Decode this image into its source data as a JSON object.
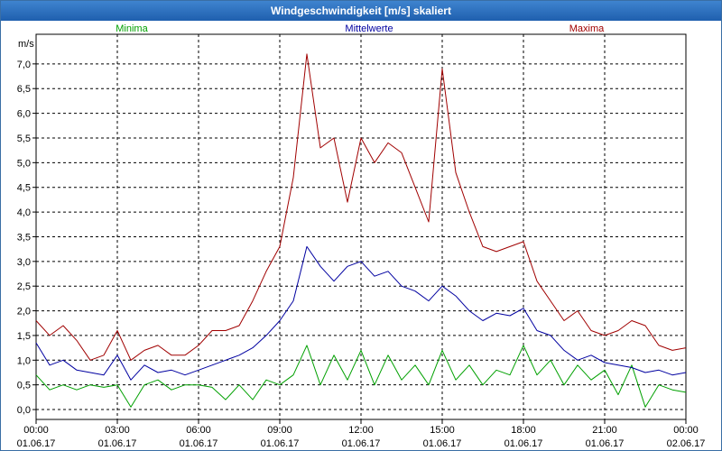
{
  "window": {
    "title": "Windgeschwindigkeit [m/s] skaliert"
  },
  "chart_data": {
    "type": "line",
    "title": "Windgeschwindigkeit [m/s] skaliert",
    "ylabel": "m/s",
    "xlabel": "",
    "ylim": [
      -0.2,
      7.6
    ],
    "xlim": [
      0,
      24
    ],
    "grid": true,
    "legend_position": "top",
    "y_ticks": [
      {
        "v": 0.0,
        "label": "0,0"
      },
      {
        "v": 0.5,
        "label": "0,5"
      },
      {
        "v": 1.0,
        "label": "1,0"
      },
      {
        "v": 1.5,
        "label": "1,5"
      },
      {
        "v": 2.0,
        "label": "2,0"
      },
      {
        "v": 2.5,
        "label": "2,5"
      },
      {
        "v": 3.0,
        "label": "3,0"
      },
      {
        "v": 3.5,
        "label": "3,5"
      },
      {
        "v": 4.0,
        "label": "4,0"
      },
      {
        "v": 4.5,
        "label": "4,5"
      },
      {
        "v": 5.0,
        "label": "5,0"
      },
      {
        "v": 5.5,
        "label": "5,5"
      },
      {
        "v": 6.0,
        "label": "6,0"
      },
      {
        "v": 6.5,
        "label": "6,5"
      },
      {
        "v": 7.0,
        "label": "7,0"
      }
    ],
    "x_ticks": [
      {
        "v": 0,
        "time": "00:00",
        "date": "01.06.17"
      },
      {
        "v": 3,
        "time": "03:00",
        "date": "01.06.17"
      },
      {
        "v": 6,
        "time": "06:00",
        "date": "01.06.17"
      },
      {
        "v": 9,
        "time": "09:00",
        "date": "01.06.17"
      },
      {
        "v": 12,
        "time": "12:00",
        "date": "01.06.17"
      },
      {
        "v": 15,
        "time": "15:00",
        "date": "01.06.17"
      },
      {
        "v": 18,
        "time": "18:00",
        "date": "01.06.17"
      },
      {
        "v": 21,
        "time": "21:00",
        "date": "01.06.17"
      },
      {
        "v": 24,
        "time": "00:00",
        "date": "02.06.17"
      }
    ],
    "series": [
      {
        "name": "Minima",
        "color": "#00a000",
        "legend_position": "left",
        "x": [
          0,
          0.5,
          1,
          1.5,
          2,
          2.5,
          3,
          3.5,
          4,
          4.5,
          5,
          5.5,
          6,
          6.5,
          7,
          7.5,
          8,
          8.5,
          9,
          9.5,
          10,
          10.5,
          11,
          11.5,
          12,
          12.5,
          13,
          13.5,
          14,
          14.5,
          15,
          15.5,
          16,
          16.5,
          17,
          17.5,
          18,
          18.5,
          19,
          19.5,
          20,
          20.5,
          21,
          21.5,
          22,
          22.5,
          23,
          23.5,
          24
        ],
        "values": [
          0.7,
          0.4,
          0.5,
          0.4,
          0.5,
          0.45,
          0.5,
          0.05,
          0.5,
          0.6,
          0.4,
          0.5,
          0.5,
          0.45,
          0.2,
          0.5,
          0.2,
          0.6,
          0.5,
          0.7,
          1.3,
          0.5,
          1.1,
          0.6,
          1.2,
          0.5,
          1.1,
          0.6,
          0.9,
          0.5,
          1.2,
          0.6,
          0.9,
          0.5,
          0.8,
          0.7,
          1.3,
          0.7,
          1.0,
          0.5,
          0.9,
          0.6,
          0.8,
          0.3,
          0.9,
          0.05,
          0.5,
          0.4,
          0.35
        ]
      },
      {
        "name": "Mittelwerte",
        "color": "#0000a0",
        "legend_position": "center",
        "x": [
          0,
          0.5,
          1,
          1.5,
          2,
          2.5,
          3,
          3.5,
          4,
          4.5,
          5,
          5.5,
          6,
          6.5,
          7,
          7.5,
          8,
          8.5,
          9,
          9.5,
          10,
          10.5,
          11,
          11.5,
          12,
          12.5,
          13,
          13.5,
          14,
          14.5,
          15,
          15.5,
          16,
          16.5,
          17,
          17.5,
          18,
          18.5,
          19,
          19.5,
          20,
          20.5,
          21,
          21.5,
          22,
          22.5,
          23,
          23.5,
          24
        ],
        "values": [
          1.35,
          0.9,
          1.0,
          0.8,
          0.75,
          0.7,
          1.1,
          0.6,
          0.9,
          0.75,
          0.8,
          0.7,
          0.8,
          0.9,
          1.0,
          1.1,
          1.25,
          1.5,
          1.8,
          2.2,
          3.3,
          2.9,
          2.6,
          2.9,
          3.0,
          2.7,
          2.8,
          2.5,
          2.4,
          2.2,
          2.5,
          2.3,
          2.0,
          1.8,
          1.95,
          1.9,
          2.05,
          1.6,
          1.5,
          1.2,
          1.0,
          1.1,
          0.95,
          0.9,
          0.85,
          0.75,
          0.8,
          0.7,
          0.75
        ]
      },
      {
        "name": "Maxima",
        "color": "#a00000",
        "legend_position": "right",
        "x": [
          0,
          0.5,
          1,
          1.5,
          2,
          2.5,
          3,
          3.5,
          4,
          4.5,
          5,
          5.5,
          6,
          6.5,
          7,
          7.5,
          8,
          8.5,
          9,
          9.5,
          10,
          10.5,
          11,
          11.5,
          12,
          12.5,
          13,
          13.5,
          14,
          14.5,
          15,
          15.5,
          16,
          16.5,
          17,
          17.5,
          18,
          18.5,
          19,
          19.5,
          20,
          20.5,
          21,
          21.5,
          22,
          22.5,
          23,
          23.5,
          24
        ],
        "values": [
          1.8,
          1.5,
          1.7,
          1.4,
          1.0,
          1.1,
          1.6,
          1.0,
          1.2,
          1.3,
          1.1,
          1.1,
          1.3,
          1.6,
          1.6,
          1.7,
          2.2,
          2.8,
          3.3,
          4.7,
          7.2,
          5.3,
          5.5,
          4.2,
          5.5,
          5.0,
          5.4,
          5.2,
          4.5,
          3.8,
          6.9,
          4.8,
          4.0,
          3.3,
          3.2,
          3.3,
          3.4,
          2.6,
          2.2,
          1.8,
          2.0,
          1.6,
          1.5,
          1.6,
          1.8,
          1.7,
          1.3,
          1.2,
          1.25
        ]
      }
    ]
  }
}
